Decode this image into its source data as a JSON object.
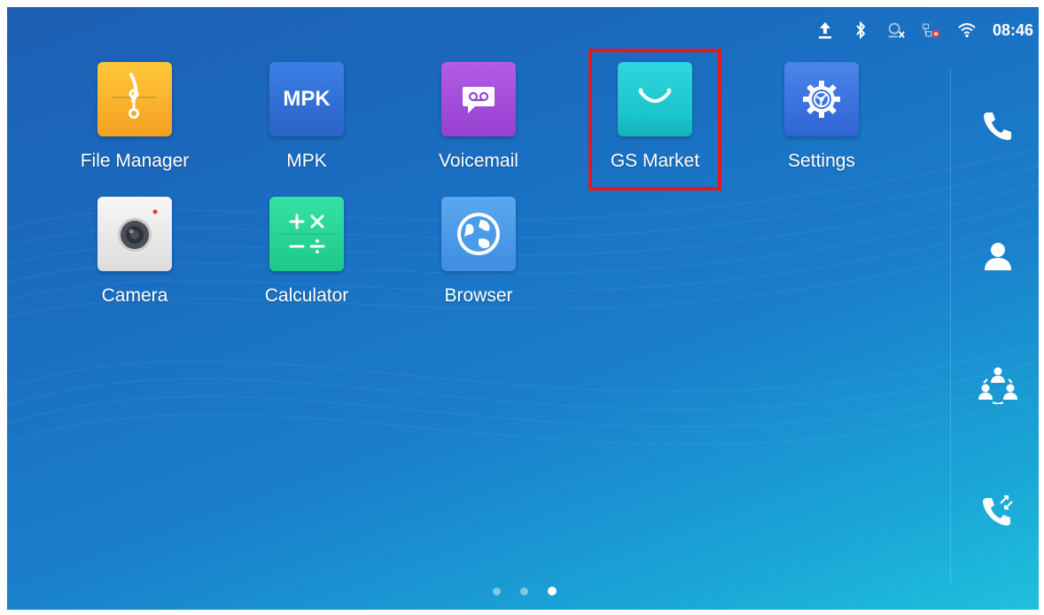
{
  "status_bar": {
    "time": "08:46",
    "icons": [
      "upload-icon",
      "bluetooth-icon",
      "account-off-icon",
      "network-error-icon",
      "wifi-icon"
    ]
  },
  "apps": [
    {
      "label": "File Manager",
      "icon": "file-manager-icon",
      "color": "#f5b02c"
    },
    {
      "label": "MPK",
      "icon": "mpk-icon",
      "icon_text": "MPK",
      "color": "#2f6fd6"
    },
    {
      "label": "Voicemail",
      "icon": "voicemail-icon",
      "color": "#a64fd8"
    },
    {
      "label": "GS Market",
      "icon": "gs-market-icon",
      "color": "#1cc5cc"
    },
    {
      "label": "Settings",
      "icon": "settings-icon",
      "color": "#3a74e0"
    },
    {
      "label": "Camera",
      "icon": "camera-icon",
      "color": "#e8e8e8"
    },
    {
      "label": "Calculator",
      "icon": "calculator-icon",
      "icon_text": "+ ×\n− ÷",
      "color": "#26d695"
    },
    {
      "label": "Browser",
      "icon": "browser-icon",
      "color": "#4a9ce8"
    }
  ],
  "highlighted_app": "GS Market",
  "highlight_color": "#e8161f",
  "sidebar": [
    "phone-icon",
    "contacts-icon",
    "conference-icon",
    "call-transfer-icon"
  ],
  "pager": {
    "pages": 3,
    "current": 3
  }
}
